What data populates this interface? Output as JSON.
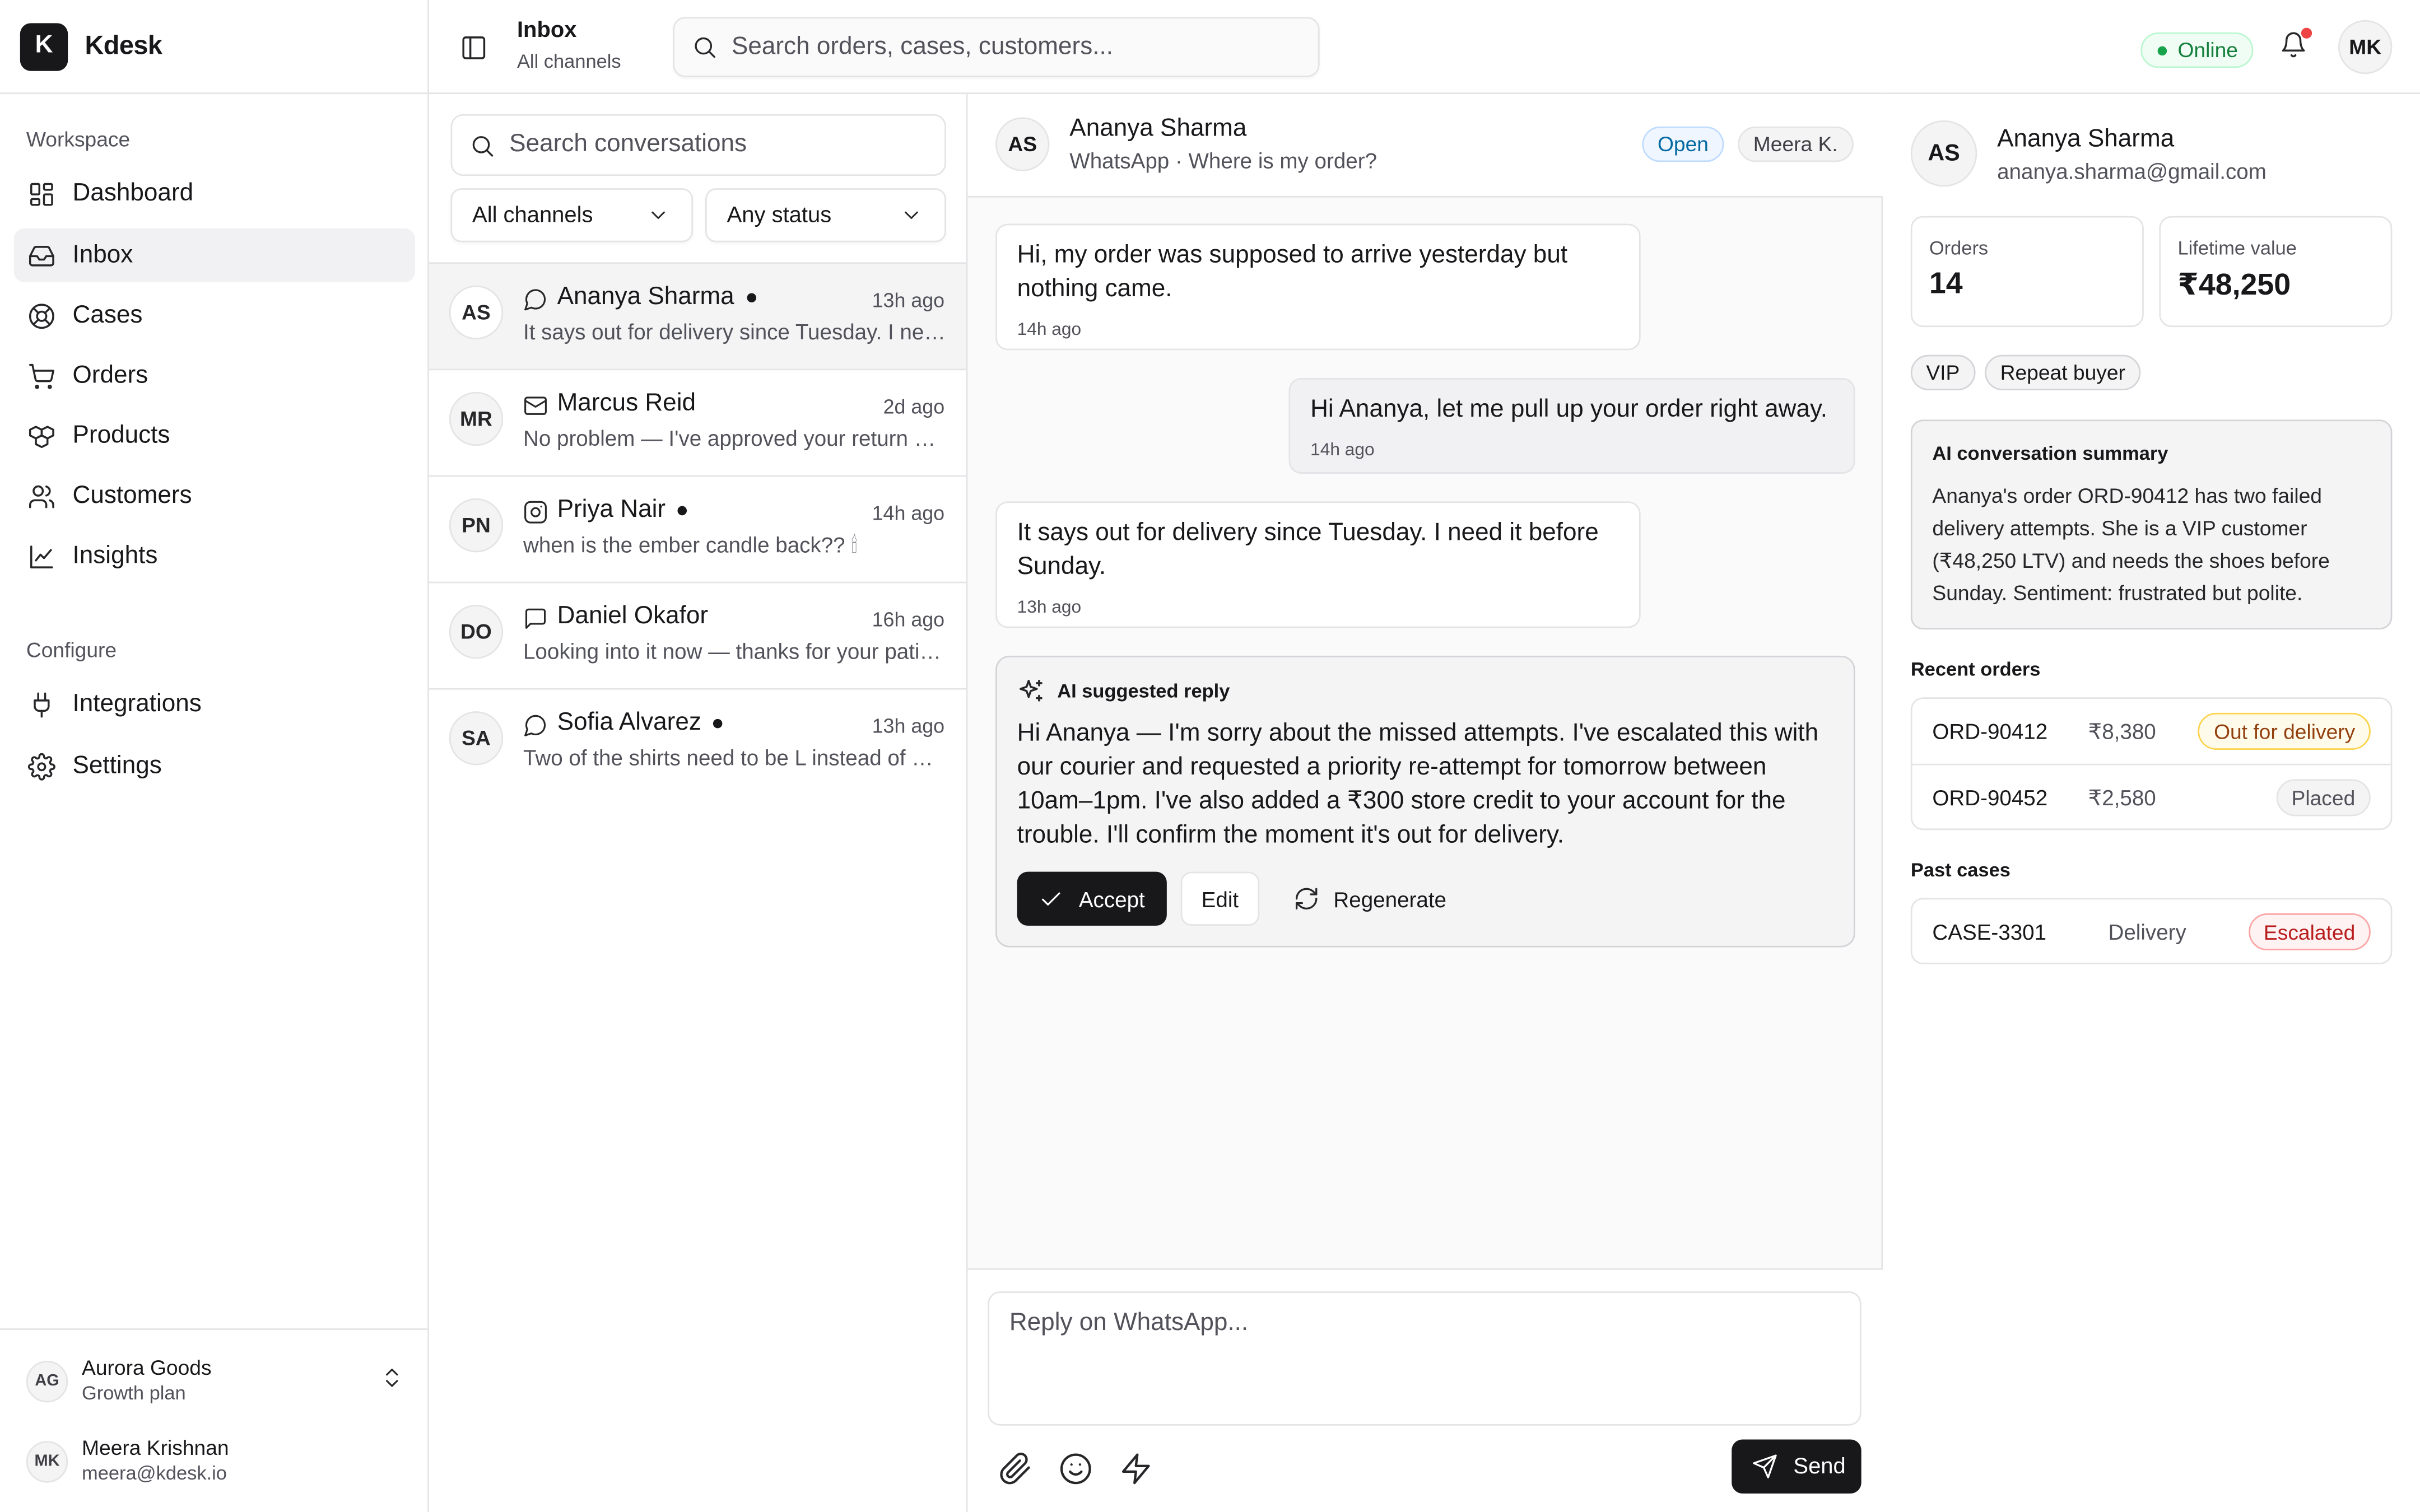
{
  "brand": {
    "logo_letter": "K",
    "name": "Kdesk"
  },
  "sidebar": {
    "workspace_label": "Workspace",
    "workspace_items": [
      {
        "label": "Dashboard",
        "icon": "dashboard-icon"
      },
      {
        "label": "Inbox",
        "icon": "inbox-icon",
        "active": true
      },
      {
        "label": "Cases",
        "icon": "lifebuoy-icon"
      },
      {
        "label": "Orders",
        "icon": "cart-icon"
      },
      {
        "label": "Products",
        "icon": "boxes-icon"
      },
      {
        "label": "Customers",
        "icon": "users-icon"
      },
      {
        "label": "Insights",
        "icon": "chart-line-icon"
      }
    ],
    "configure_label": "Configure",
    "configure_items": [
      {
        "label": "Integrations",
        "icon": "plug-icon"
      },
      {
        "label": "Settings",
        "icon": "gear-icon"
      }
    ],
    "org": {
      "initials": "AG",
      "name": "Aurora Goods",
      "plan": "Growth plan"
    },
    "user": {
      "initials": "MK",
      "name": "Meera Krishnan",
      "email": "meera@kdesk.io"
    }
  },
  "topbar": {
    "title": "Inbox",
    "subtitle": "All channels",
    "search_placeholder": "Search orders, cases, customers...",
    "status": "Online",
    "user_initials": "MK"
  },
  "conversations": {
    "search_placeholder": "Search conversations",
    "channel_filter": "All channels",
    "status_filter": "Any status",
    "items": [
      {
        "initials": "AS",
        "name": "Ananya Sharma",
        "channel": "whatsapp-icon",
        "unread": true,
        "time": "13h ago",
        "preview": "It says out for delivery since Tuesday. I need it before Sunday.",
        "selected": true
      },
      {
        "initials": "MR",
        "name": "Marcus Reid",
        "channel": "mail-icon",
        "unread": false,
        "time": "2d ago",
        "preview": "No problem — I've approved your return and sent a label.",
        "selected": false
      },
      {
        "initials": "PN",
        "name": "Priya Nair",
        "channel": "instagram-icon",
        "unread": true,
        "time": "14h ago",
        "preview": "when is the ember candle back?? 🕯",
        "selected": false
      },
      {
        "initials": "DO",
        "name": "Daniel Okafor",
        "channel": "chat-icon",
        "unread": false,
        "time": "16h ago",
        "preview": "Looking into it now — thanks for your patience.",
        "selected": false
      },
      {
        "initials": "SA",
        "name": "Sofia Alvarez",
        "channel": "whatsapp-icon",
        "unread": true,
        "time": "13h ago",
        "preview": "Two of the shirts need to be L instead of M — can you swap them?",
        "selected": false
      }
    ]
  },
  "chat": {
    "initials": "AS",
    "name": "Ananya Sharma",
    "subtitle": "WhatsApp · Where is my order?",
    "status": "Open",
    "assignee": "Meera K.",
    "messages": [
      {
        "text": "Hi, my order was supposed to arrive yesterday but nothing came.",
        "time": "14h ago",
        "dir": "in"
      },
      {
        "text": "Hi Ananya, let me pull up your order right away.",
        "time": "14h ago",
        "dir": "out"
      },
      {
        "text": "It says out for delivery since Tuesday. I need it before Sunday.",
        "time": "13h ago",
        "dir": "in"
      }
    ],
    "ai": {
      "title": "AI suggested reply",
      "text": "Hi Ananya — I'm sorry about the missed attempts. I've escalated this with our courier and requested a priority re-attempt for tomorrow between 10am–1pm. I've also added a ₹300 store credit to your account for the trouble. I'll confirm the moment it's out for delivery.",
      "accept": "Accept",
      "edit": "Edit",
      "regenerate": "Regenerate"
    },
    "composer_placeholder": "Reply on WhatsApp...",
    "send": "Send"
  },
  "customer": {
    "initials": "AS",
    "name": "Ananya Sharma",
    "email": "ananya.sharma@gmail.com",
    "orders_label": "Orders",
    "orders_value": "14",
    "ltv_label": "Lifetime value",
    "ltv_value": "₹48,250",
    "tags": [
      "VIP",
      "Repeat buyer"
    ],
    "summary_title": "AI conversation summary",
    "summary_text": "Ananya's order ORD-90412 has two failed delivery attempts. She is a VIP customer (₹48,250 LTV) and needs the shoes before Sunday. Sentiment: frustrated but polite.",
    "recent_orders_label": "Recent orders",
    "recent_orders": [
      {
        "id": "ORD-90412",
        "amount": "₹8,380",
        "status": "Out for delivery",
        "tone": "amber"
      },
      {
        "id": "ORD-90452",
        "amount": "₹2,580",
        "status": "Placed",
        "tone": "gray"
      }
    ],
    "past_cases_label": "Past cases",
    "past_cases": [
      {
        "id": "CASE-3301",
        "type": "Delivery",
        "status": "Escalated",
        "tone": "red"
      }
    ]
  },
  "colors": {
    "accent": "#18181b",
    "online": "#16a34a",
    "notification": "#ef4444",
    "open_badge": "#0369a1",
    "escalated": "#b91c1c",
    "pending": "#92400e"
  }
}
